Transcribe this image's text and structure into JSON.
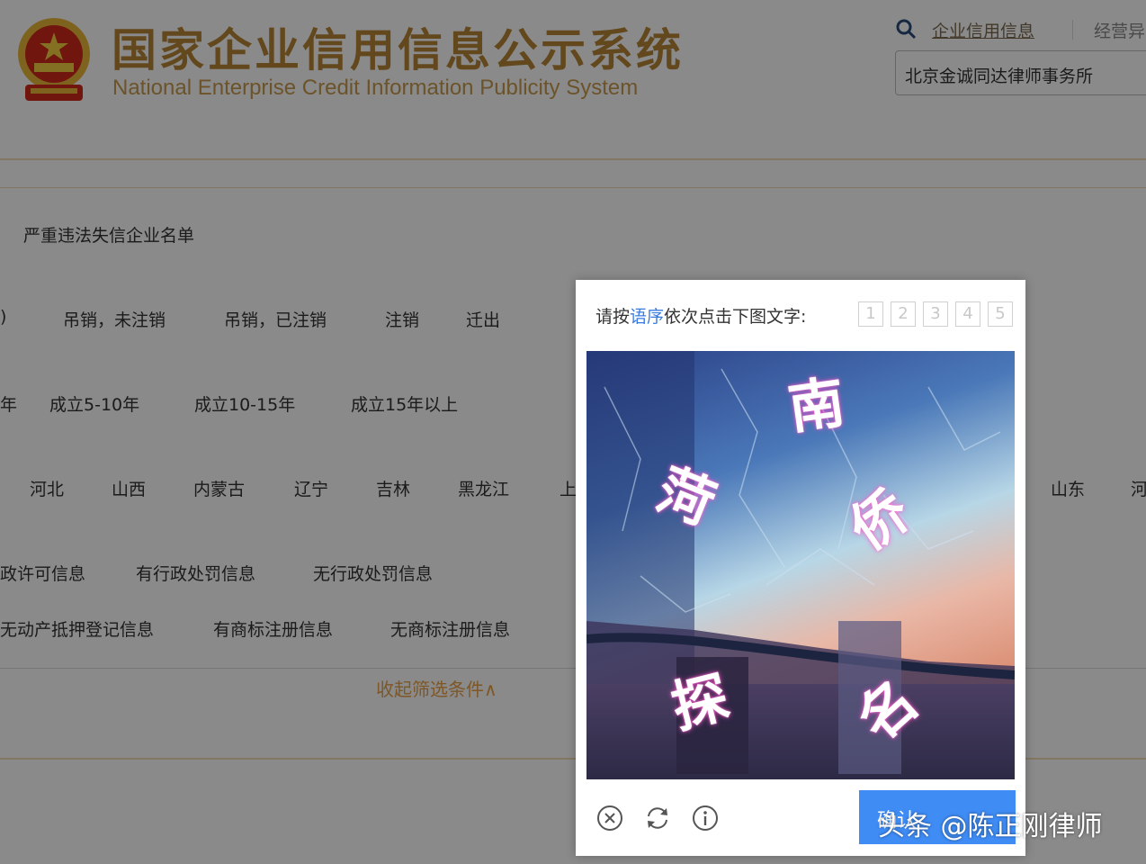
{
  "header": {
    "title_cn": "国家企业信用信息公示系统",
    "title_en": "National Enterprise Credit Information Publicity System",
    "nav_link": "企业信用信息",
    "nav_link_partial": "经营异",
    "search_value": "北京金诚同达律师事务所"
  },
  "filters": {
    "blacklist_label": "严重违法失信企业名单",
    "status": {
      "lead_fragment": ")",
      "options": [
        "吊销，未注销",
        "吊销，已注销",
        "注销",
        "迁出"
      ]
    },
    "age": {
      "lead_fragment": "年",
      "options": [
        "成立5-10年",
        "成立10-15年",
        "成立15年以上"
      ]
    },
    "region": {
      "options": [
        "河北",
        "山西",
        "内蒙古",
        "辽宁",
        "吉林",
        "黑龙江"
      ],
      "fragment_1": "上",
      "right_options": [
        "山东"
      ],
      "fragment_2": "河"
    },
    "license_row": [
      "政许可信息",
      "有行政处罚信息",
      "无行政处罚信息"
    ],
    "property_row": [
      "无动产抵押登记信息",
      "有商标注册信息",
      "无商标注册信息"
    ],
    "collapse_label": "收起筛选条件∧"
  },
  "captcha": {
    "instruction_prefix": "请按",
    "instruction_highlight": "语序",
    "instruction_suffix": "依次点击下图文字:",
    "slots": [
      "1",
      "2",
      "3",
      "4",
      "5"
    ],
    "characters": [
      "南",
      "侨",
      "菏",
      "探",
      "名"
    ],
    "submit_label": "确认",
    "icons": [
      "close-circle-icon",
      "refresh-icon",
      "info-icon"
    ],
    "accent_color": "#3f8cf5"
  },
  "watermark": "头条 @陈正刚律师"
}
